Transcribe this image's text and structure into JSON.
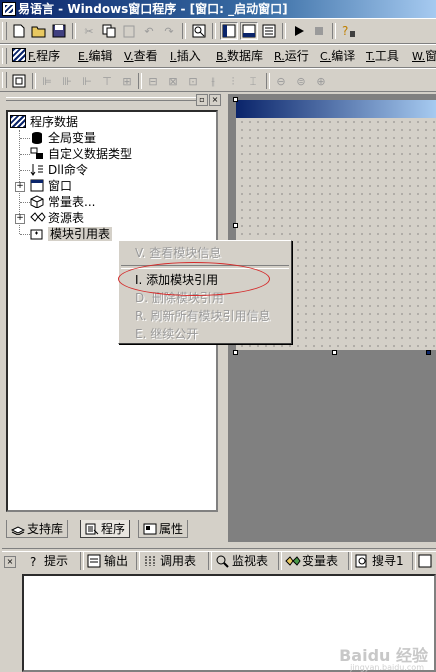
{
  "window": {
    "title": "易语言 - Windows窗口程序 - [窗口: _启动窗口]"
  },
  "menubar": {
    "items": [
      {
        "mnemonic": "F.",
        "label": "程序"
      },
      {
        "mnemonic": "E.",
        "label": "编辑"
      },
      {
        "mnemonic": "V.",
        "label": "查看"
      },
      {
        "mnemonic": "I.",
        "label": "插入"
      },
      {
        "mnemonic": "B.",
        "label": "数据库"
      },
      {
        "mnemonic": "R.",
        "label": "运行"
      },
      {
        "mnemonic": "C.",
        "label": "编译"
      },
      {
        "mnemonic": "T.",
        "label": "工具"
      },
      {
        "mnemonic": "W.",
        "label": "窗"
      }
    ]
  },
  "tree": {
    "root": "程序数据",
    "items": [
      {
        "label": "全局变量",
        "icon": "database-icon"
      },
      {
        "label": "自定义数据类型",
        "icon": "type-icon"
      },
      {
        "label": "Dll命令",
        "icon": "dll-icon"
      },
      {
        "label": "窗口",
        "icon": "window-icon"
      },
      {
        "label": "常量表...",
        "icon": "constant-icon"
      },
      {
        "label": "资源表",
        "icon": "resource-icon"
      },
      {
        "label": "模块引用表",
        "icon": "module-icon"
      }
    ]
  },
  "left_tabs": [
    {
      "label": "支持库",
      "icon": "library-icon"
    },
    {
      "label": "程序",
      "icon": "program-icon"
    },
    {
      "label": "属性",
      "icon": "property-icon"
    }
  ],
  "context_menu": {
    "items": [
      {
        "label": "V. 查看模块信息",
        "enabled": false
      },
      {
        "label": "I. 添加模块引用",
        "enabled": true
      },
      {
        "label": "D. 删除模块引用",
        "enabled": false
      },
      {
        "label": "R. 刷新所有模块引用信息",
        "enabled": false
      },
      {
        "label": "E. 继续公开",
        "enabled": false
      }
    ]
  },
  "bottom_tabs": [
    {
      "label": "提示",
      "icon": "hint-icon"
    },
    {
      "label": "输出",
      "icon": "output-icon"
    },
    {
      "label": "调用表",
      "icon": "callstack-icon"
    },
    {
      "label": "监视表",
      "icon": "watch-icon"
    },
    {
      "label": "变量表",
      "icon": "variable-icon"
    },
    {
      "label": "搜寻1",
      "icon": "search-icon"
    }
  ],
  "watermark": {
    "text": "Baidu 经验",
    "sub": "jingyan.baidu.com"
  },
  "colors": {
    "titlebar": "#0a246a",
    "face": "#d4d0c8",
    "highlight_ellipse": "#d42a2a"
  }
}
